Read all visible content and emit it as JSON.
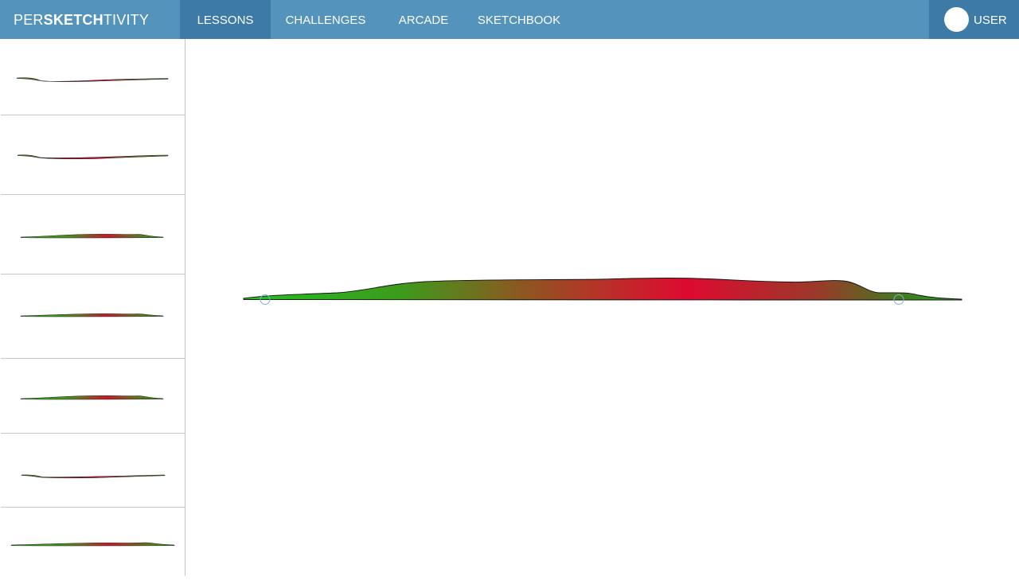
{
  "header": {
    "logo": {
      "prefix": "PER",
      "middle": "SKETCH",
      "suffix": "TIVITY"
    },
    "nav": {
      "lessons": "LESSONS",
      "challenges": "CHALLENGES",
      "arcade": "ARCADE",
      "sketchbook": "SKETCHBOOK"
    },
    "user_label": "USER",
    "active_tab": "LESSONS"
  },
  "colors": {
    "header_bg": "#5393bc",
    "header_active_bg": "#3d7aa6",
    "stroke_good": "#1fb51f",
    "stroke_bad": "#d40a2e"
  },
  "sidebar": {
    "attempt_count": 7
  }
}
